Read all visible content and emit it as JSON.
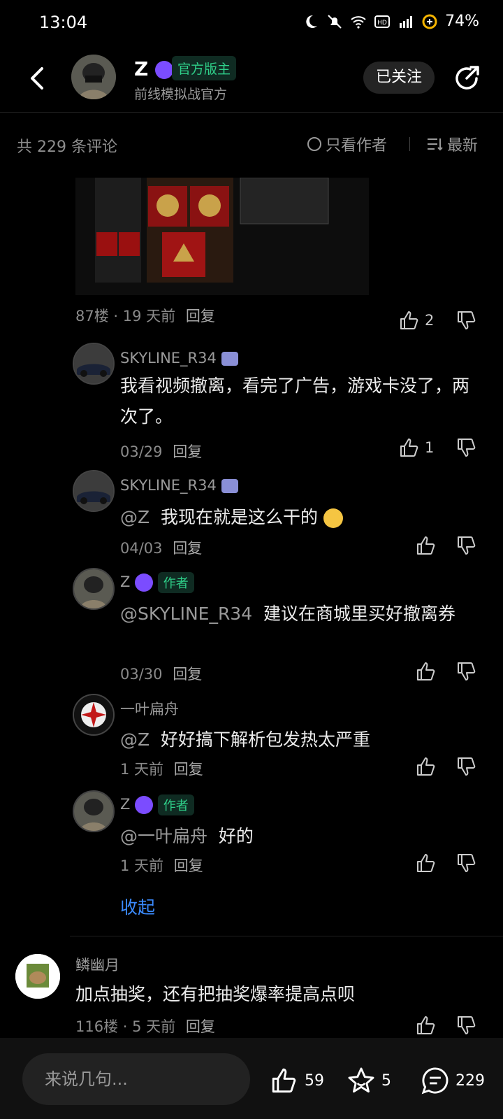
{
  "status": {
    "time": "13:04",
    "battery": "74%"
  },
  "header": {
    "name": "Z",
    "tag": "官方版主",
    "subtitle": "前线模拟战官方",
    "follow_label": "已关注"
  },
  "sortbar": {
    "count_label": "共 229 条评论",
    "only_author": "只看作者",
    "sort_label": "最新"
  },
  "top_comment": {
    "meta": "87楼 · 19 天前",
    "reply": "回复",
    "likes": "2"
  },
  "replies": [
    {
      "nick": "SKYLINE_R34",
      "text": "我看视频撤离，看完了广告，游戏卡没了，两次了。",
      "date": "03/29",
      "reply": "回复",
      "likes": "1"
    },
    {
      "nick": "SKYLINE_R34",
      "mention": "@Z",
      "text": "我现在就是这么干的",
      "date": "04/03",
      "reply": "回复",
      "likes": ""
    },
    {
      "nick": "Z",
      "tag": "作者",
      "mention": "@SKYLINE_R34",
      "text": "建议在商城里买好撤离券",
      "date": "03/30",
      "reply": "回复",
      "likes": ""
    },
    {
      "nick": "一叶扁舟",
      "mention": "@Z",
      "text": "好好搞下解析包发热太严重",
      "date": "1 天前",
      "reply": "回复",
      "likes": ""
    },
    {
      "nick": "Z",
      "tag": "作者",
      "mention": "@一叶扁舟",
      "text": "好的",
      "date": "1 天前",
      "reply": "回复",
      "likes": ""
    }
  ],
  "collapse_label": "收起",
  "next_comment": {
    "nick": "鳞幽月",
    "text": "加点抽奖，还有把抽奖爆率提高点呗",
    "meta": "116楼 · 5 天前",
    "reply": "回复"
  },
  "bottom": {
    "placeholder": "来说几句...",
    "likes": "59",
    "stars": "5",
    "comments": "229"
  }
}
